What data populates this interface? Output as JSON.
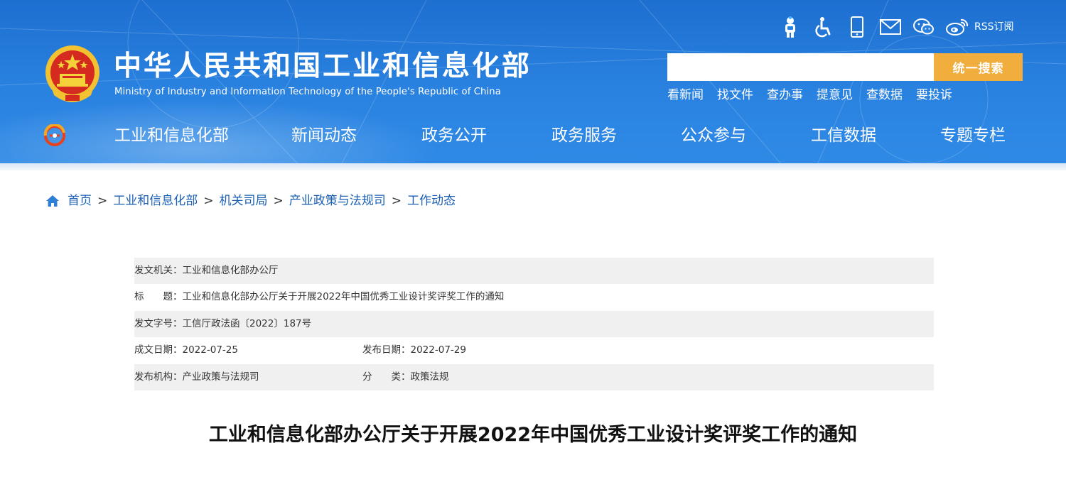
{
  "header": {
    "site_title": "中华人民共和国工业和信息化部",
    "site_subtitle": "Ministry of Industry and Information Technology of the People's Republic of China",
    "tools": [
      {
        "icon": "robot-assistant-icon"
      },
      {
        "icon": "accessibility-icon"
      },
      {
        "icon": "mobile-phone-icon"
      },
      {
        "icon": "mail-icon"
      },
      {
        "icon": "wechat-icon"
      },
      {
        "icon": "weibo-icon"
      }
    ],
    "rss_label": "RSS订阅",
    "search": {
      "placeholder": "",
      "value": "",
      "button_label": "统一搜索"
    },
    "quick_links": [
      "看新闻",
      "找文件",
      "查办事",
      "提意见",
      "查数据",
      "要投诉"
    ],
    "colors": {
      "header_blue": "#2a82e0",
      "search_button": "#f1ae3d",
      "link_blue": "#1a5fb4"
    }
  },
  "nav": {
    "items": [
      "工业和信息化部",
      "新闻动态",
      "政务公开",
      "政务服务",
      "公众参与",
      "工信数据",
      "专题专栏"
    ]
  },
  "breadcrumb": {
    "items": [
      "首页",
      "工业和信息化部",
      "机关司局",
      "产业政策与法规司",
      "工作动态"
    ],
    "separator": ">"
  },
  "doc_info": {
    "issuer_label": "发文机关：",
    "issuer_value": "工业和信息化部办公厅",
    "title_label": "标　　题：",
    "title_value": "工业和信息化部办公厅关于开展2022年中国优秀工业设计奖评奖工作的通知",
    "doc_no_label": "发文字号：",
    "doc_no_value": "工信厅政法函〔2022〕187号",
    "created_label": "成文日期：",
    "created_value": "2022-07-25",
    "published_label": "发布日期：",
    "published_value": "2022-07-29",
    "org_label": "发布机构：",
    "org_value": "产业政策与法规司",
    "category_label": "分　　类：",
    "category_value": "政策法规"
  },
  "article": {
    "title": "工业和信息化部办公厅关于开展2022年中国优秀工业设计奖评奖工作的通知"
  }
}
